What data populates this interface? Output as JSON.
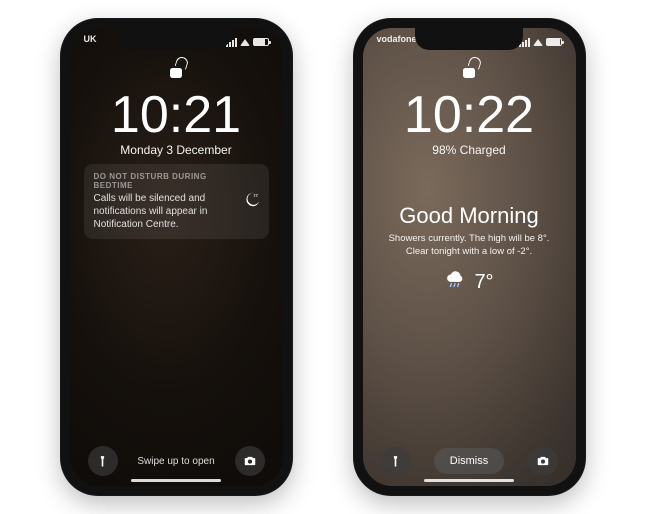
{
  "left": {
    "carrier": "UK",
    "time": "10:21",
    "date": "Monday 3 December",
    "dnd_title": "DO NOT DISTURB DURING BEDTIME",
    "dnd_body": "Calls will be silenced and notifications will appear in Notification Centre.",
    "swipe": "Swipe up to open"
  },
  "right": {
    "carrier": "vodafone U",
    "time": "10:22",
    "charge": "98% Charged",
    "greeting": "Good Morning",
    "forecast": "Showers currently. The high will be 8°. Clear tonight with a low of -2°.",
    "temp": "7°",
    "dismiss": "Dismiss"
  }
}
